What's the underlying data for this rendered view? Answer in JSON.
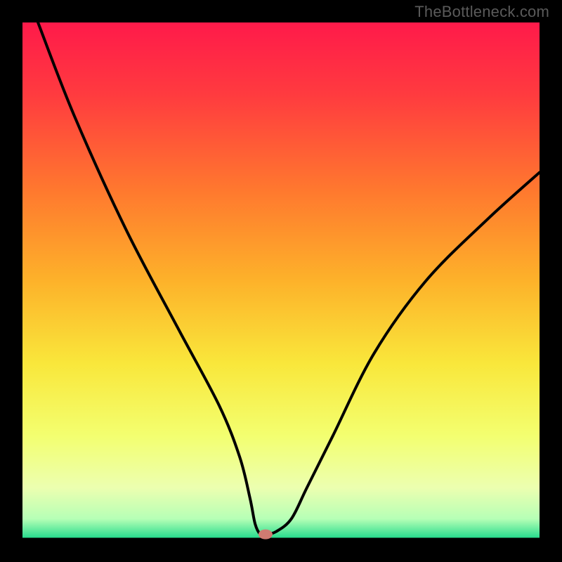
{
  "watermark": "TheBottleneck.com",
  "chart_data": {
    "type": "line",
    "title": "",
    "xlabel": "",
    "ylabel": "",
    "xlim": [
      0,
      100
    ],
    "ylim": [
      0,
      100
    ],
    "series": [
      {
        "name": "curve",
        "x": [
          3,
          10,
          20,
          30,
          38,
          42,
          44,
          45,
          46,
          47,
          49,
          52,
          55,
          60,
          68,
          78,
          90,
          100
        ],
        "y": [
          100,
          82,
          60,
          41,
          26,
          16,
          8,
          3,
          1,
          1,
          1.5,
          4,
          10,
          20,
          36,
          50,
          62,
          71
        ]
      }
    ],
    "marker": {
      "x": 47,
      "y": 1
    },
    "gradient_stops": [
      {
        "offset": 0,
        "color": "#ff1a4a"
      },
      {
        "offset": 14,
        "color": "#ff3b3f"
      },
      {
        "offset": 33,
        "color": "#ff7a2e"
      },
      {
        "offset": 50,
        "color": "#fdb22a"
      },
      {
        "offset": 66,
        "color": "#f9e73b"
      },
      {
        "offset": 80,
        "color": "#f3ff70"
      },
      {
        "offset": 90,
        "color": "#ecffb0"
      },
      {
        "offset": 96,
        "color": "#b6ffb6"
      },
      {
        "offset": 100,
        "color": "#1bd98a"
      }
    ]
  }
}
